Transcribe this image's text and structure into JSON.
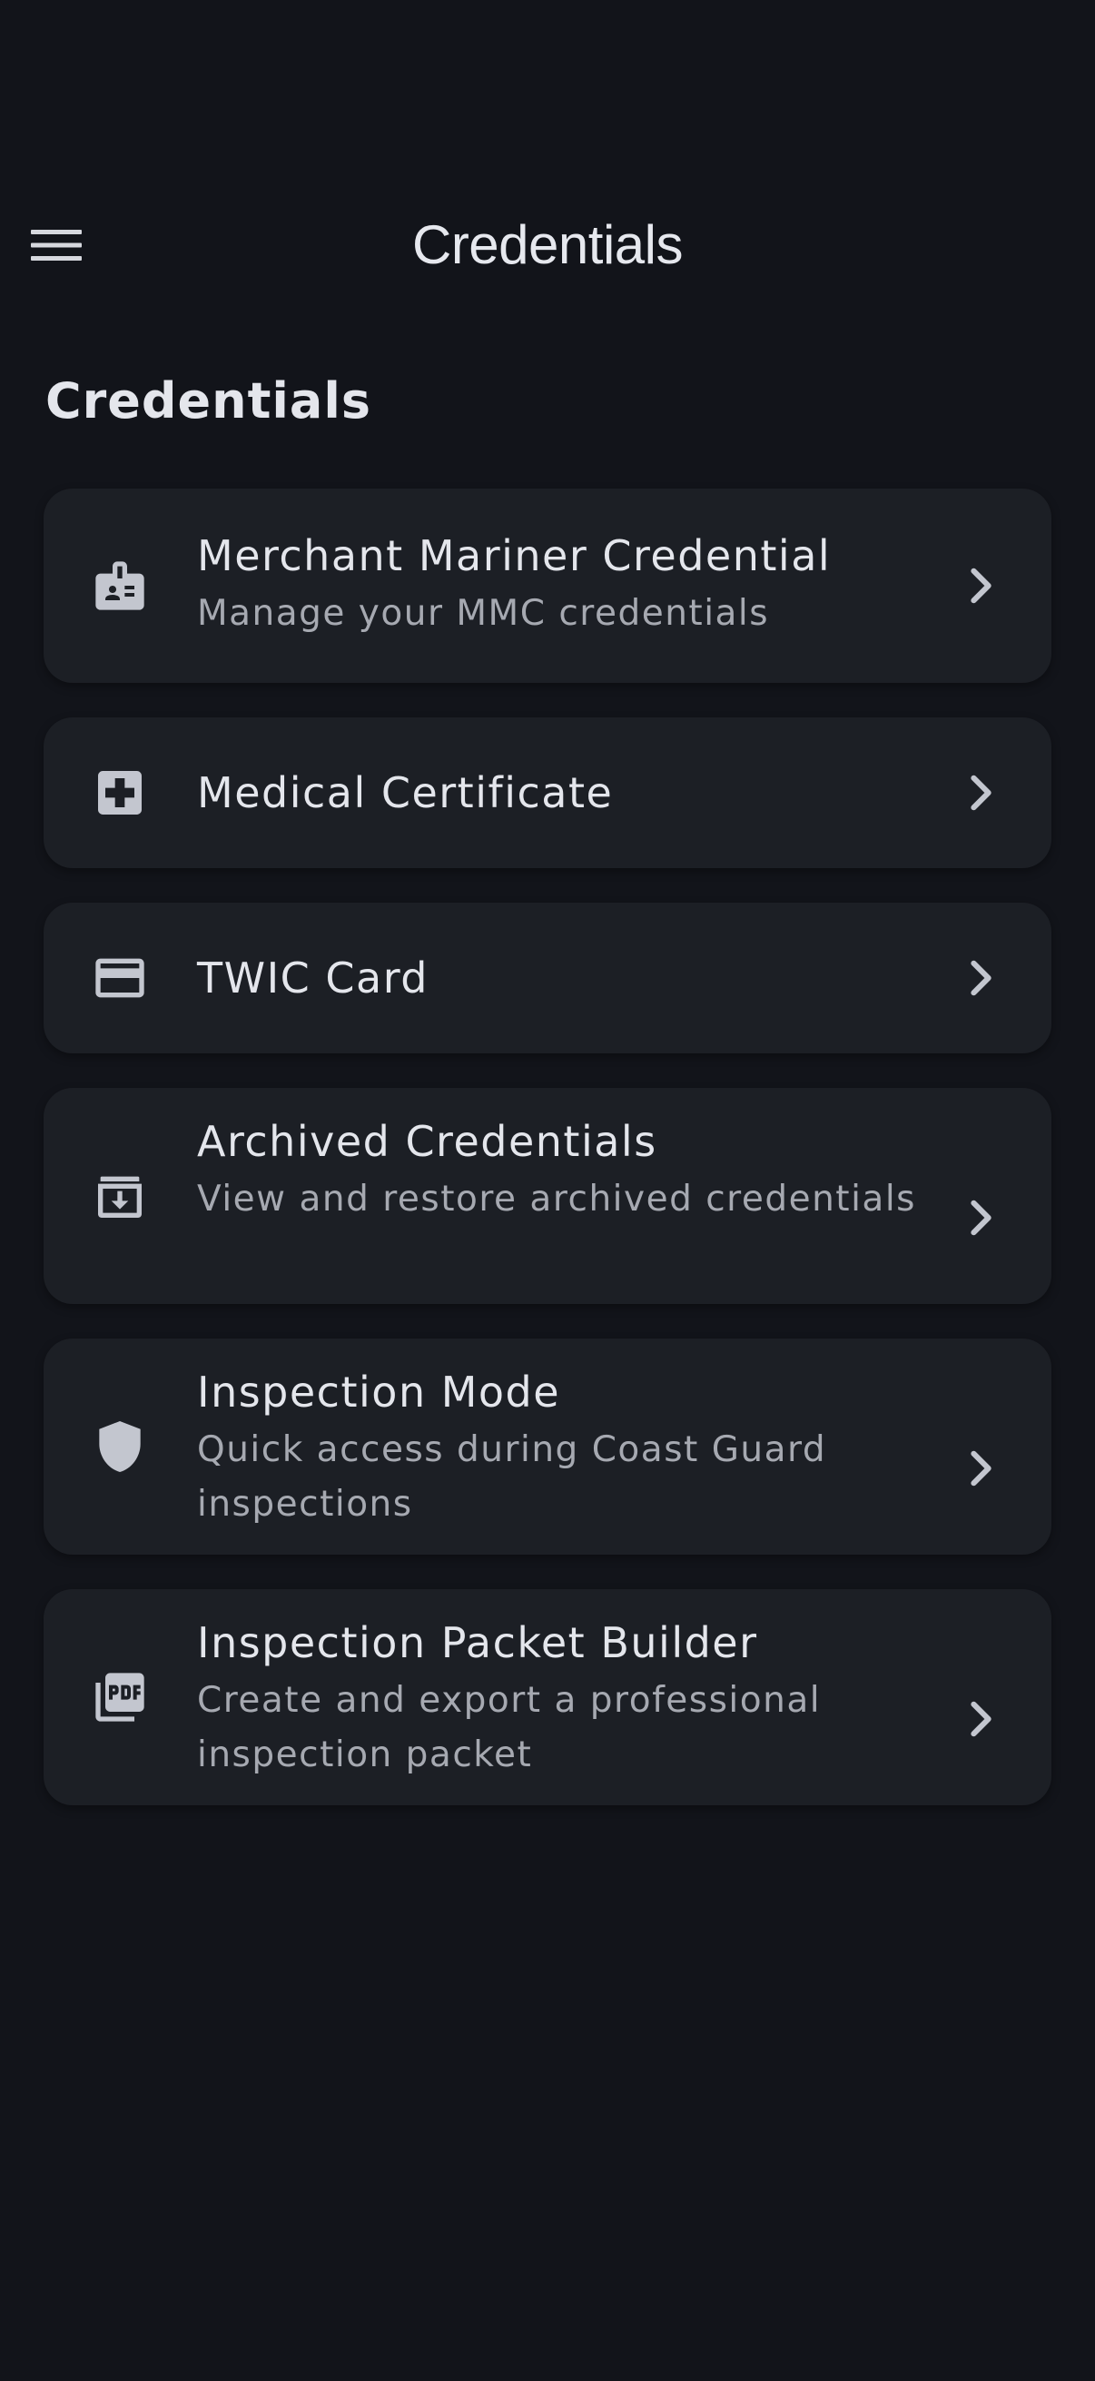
{
  "app_bar": {
    "title": "Credentials"
  },
  "section": {
    "title": "Credentials"
  },
  "items": [
    {
      "title": "Merchant Mariner Credential",
      "subtitle": "Manage your MMC credentials",
      "icon": "badge-icon"
    },
    {
      "title": "Medical Certificate",
      "subtitle": "",
      "icon": "medical-services-icon"
    },
    {
      "title": "TWIC Card",
      "subtitle": "",
      "icon": "credit-card-icon"
    },
    {
      "title": "Archived Credentials",
      "subtitle": "View and restore archived credentials",
      "icon": "archive-icon"
    },
    {
      "title": "Inspection Mode",
      "subtitle": "Quick access during Coast Guard inspections",
      "icon": "shield-icon"
    },
    {
      "title": "Inspection Packet Builder",
      "subtitle": "Create and export a professional inspection packet",
      "icon": "picture-as-pdf-icon"
    }
  ],
  "colors": {
    "background": "#12141a",
    "card": "#1c1f25",
    "text_primary": "#e4e6ec",
    "text_secondary": "#a6a9b1",
    "icon": "#c3c6cf"
  }
}
